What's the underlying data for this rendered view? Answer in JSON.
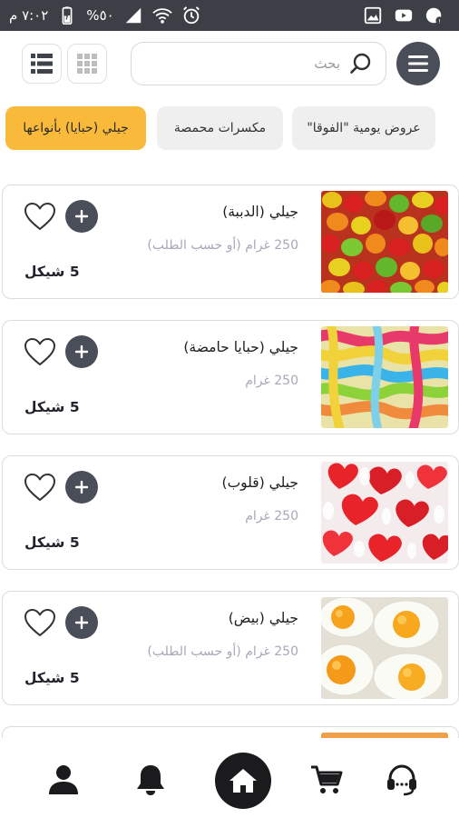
{
  "status_bar": {
    "time": "٧:٠٢ م",
    "battery": "%٥٠"
  },
  "header": {
    "search_placeholder": "بحث"
  },
  "categories": [
    {
      "label": "عروض يومية \"الفوقا\"",
      "active": false
    },
    {
      "label": "مكسرات محمصة",
      "active": false
    },
    {
      "label": "جيلي (حبايا) بأنواعها",
      "active": true
    }
  ],
  "products": [
    {
      "name": "جيلي (الدببة)",
      "weight": "250 غرام (أو حسب الطلب)",
      "price": "5 شيكل",
      "image": "gummy-bears"
    },
    {
      "name": "جيلي (حبايا حامضة)",
      "weight": "250 غرام",
      "price": "5 شيكل",
      "image": "sour-worms"
    },
    {
      "name": "جيلي (قلوب)",
      "weight": "250 غرام",
      "price": "5 شيكل",
      "image": "jelly-hearts"
    },
    {
      "name": "جيلي (بيض)",
      "weight": "250 غرام (أو حسب الطلب)",
      "price": "5 شيكل",
      "image": "fried-eggs"
    }
  ],
  "bottom_nav": [
    {
      "name": "profile",
      "icon": "user-icon"
    },
    {
      "name": "notifications",
      "icon": "bell-icon"
    },
    {
      "name": "home",
      "icon": "home-icon"
    },
    {
      "name": "cart",
      "icon": "cart-icon"
    },
    {
      "name": "support",
      "icon": "headset-icon"
    }
  ],
  "colors": {
    "accent": "#f9b93a",
    "dark": "#4a4e58",
    "status_bar": "#3c3f45",
    "muted_text": "#a8a8b8"
  }
}
